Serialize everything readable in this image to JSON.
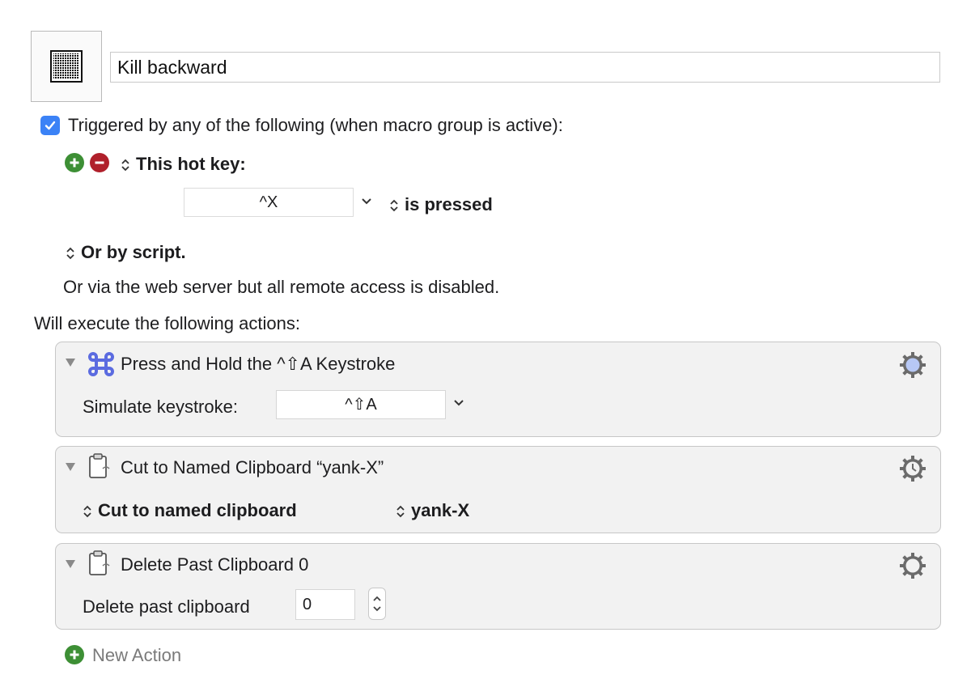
{
  "macro": {
    "name": "Kill backward",
    "icon": "grid-icon"
  },
  "triggers": {
    "enabled_label": "Triggered by any of the following (when macro group is active):",
    "hotkey_label": "This hot key:",
    "hotkey_value": "^X",
    "hotkey_condition": "is pressed",
    "script_label": "Or by script.",
    "web_server_text": "Or via the web server but all remote access is disabled."
  },
  "actions_heading": "Will execute the following actions:",
  "actions": [
    {
      "title": "Press and Hold the ^⇧A Keystroke",
      "field_label": "Simulate keystroke:",
      "field_value": "^⇧A"
    },
    {
      "title": "Cut to Named Clipboard “yank-X”",
      "option_label": "Cut to named clipboard",
      "option_value": "yank-X"
    },
    {
      "title": "Delete Past Clipboard 0",
      "field_label": "Delete past clipboard",
      "field_value": "0"
    }
  ],
  "new_action_label": "New Action",
  "colors": {
    "accent_blue": "#3b82f6",
    "add_green": "#3d8f35",
    "remove_red": "#b0202b",
    "keystroke_icon": "#5b6be0"
  }
}
